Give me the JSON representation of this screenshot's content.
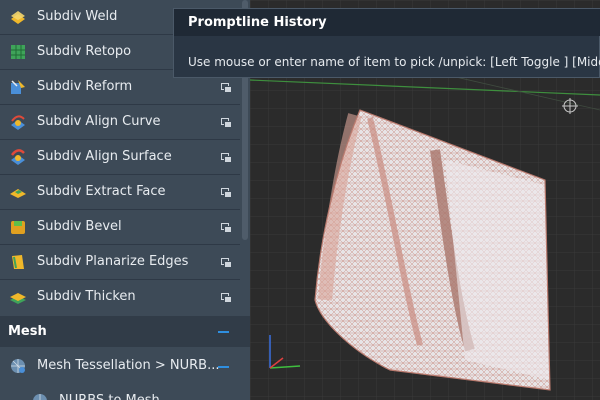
{
  "palette": {
    "tools": [
      {
        "label": "Subdiv Weld",
        "icon": "subdiv-weld-icon"
      },
      {
        "label": "Subdiv Retopo",
        "icon": "subdiv-retopo-icon"
      },
      {
        "label": "Subdiv Reform",
        "icon": "subdiv-reform-icon"
      },
      {
        "label": "Subdiv Align Curve",
        "icon": "subdiv-align-curve-icon"
      },
      {
        "label": "Subdiv Align Surface",
        "icon": "subdiv-align-surface-icon"
      },
      {
        "label": "Subdiv Extract Face",
        "icon": "subdiv-extract-face-icon"
      },
      {
        "label": "Subdiv Bevel",
        "icon": "subdiv-bevel-icon"
      },
      {
        "label": "Subdiv Planarize Edges",
        "icon": "subdiv-planarize-edges-icon"
      },
      {
        "label": "Subdiv Thicken",
        "icon": "subdiv-thicken-icon"
      }
    ],
    "section": {
      "title": "Mesh"
    },
    "mesh_tools": [
      {
        "label": "Mesh Tessellation > NURB...",
        "icon": "mesh-tessellation-icon"
      },
      {
        "label": "NURBS to Mesh",
        "icon": "nurbs-to-mesh-icon"
      }
    ]
  },
  "promptline": {
    "title": "Promptline History",
    "message": "Use mouse or enter name of item to pick /unpick: [Left Toggle ] [Middle"
  },
  "colors": {
    "panel_bg": "#3d4a57",
    "section_bg": "#313c48",
    "accent_blue": "#2f8fe0",
    "viewport_bg": "#2b2b2b",
    "mesh_wire": "#c98b80"
  }
}
